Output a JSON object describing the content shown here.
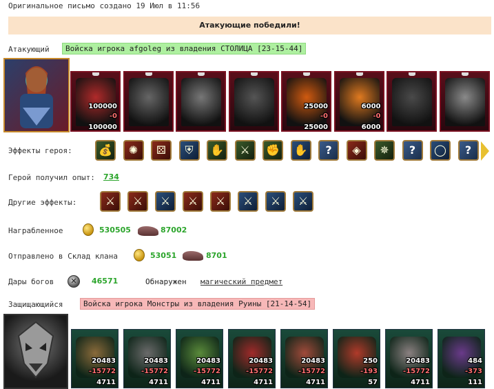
{
  "header": {
    "date_text": "Оригинальное письмо создано 19 Июл в 11:56"
  },
  "banner": {
    "text": "Атакующие победили!"
  },
  "attacker": {
    "label": "Атакующий",
    "tag": "Войска игрока afgoleg из владения СТОЛИЦА [23-15-44]",
    "portrait_icon": "hero-portrait",
    "units": [
      {
        "icon": "red-dragon-unit",
        "top": "100000",
        "delta": "-0",
        "bottom": "100000",
        "color": "#b02a2a"
      },
      {
        "icon": "skeleton-lord-unit",
        "top": "",
        "delta": "",
        "bottom": "",
        "color": "#666666"
      },
      {
        "icon": "ghoul-unit",
        "top": "",
        "delta": "",
        "bottom": "",
        "color": "#777777"
      },
      {
        "icon": "gargoyle-unit",
        "top": "",
        "delta": "",
        "bottom": "",
        "color": "#555555"
      },
      {
        "icon": "fire-elemental-unit",
        "top": "25000",
        "delta": "-0",
        "bottom": "25000",
        "color": "#d05a10"
      },
      {
        "icon": "flame-warrior-unit",
        "top": "6000",
        "delta": "-0",
        "bottom": "6000",
        "color": "#e07a20"
      },
      {
        "icon": "demon-lord-unit",
        "top": "",
        "delta": "",
        "bottom": "",
        "color": "#4a4a4a"
      },
      {
        "icon": "wraith-unit",
        "top": "",
        "delta": "",
        "bottom": "",
        "color": "#8a8a8a"
      }
    ]
  },
  "hero_effects": {
    "label": "Эффекты героя:",
    "items": [
      {
        "icon": "gold-bag-icon",
        "glyph": "💰",
        "style": ""
      },
      {
        "icon": "crab-icon",
        "glyph": "✺",
        "style": "red"
      },
      {
        "icon": "dice-icon",
        "glyph": "⚄",
        "style": "red"
      },
      {
        "icon": "shield-icon",
        "glyph": "⛨",
        "style": "blue"
      },
      {
        "icon": "shield-hand-icon",
        "glyph": "✋",
        "style": ""
      },
      {
        "icon": "green-sword-icon",
        "glyph": "⚔",
        "style": ""
      },
      {
        "icon": "handshake-icon",
        "glyph": "✊",
        "style": ""
      },
      {
        "icon": "blue-hand-icon",
        "glyph": "✋",
        "style": "blue"
      },
      {
        "icon": "question-icon",
        "glyph": "?",
        "style": "q"
      },
      {
        "icon": "red-amulet-icon",
        "glyph": "◈",
        "style": "red"
      },
      {
        "icon": "star-gear-icon",
        "glyph": "✵",
        "style": ""
      },
      {
        "icon": "question-icon",
        "glyph": "?",
        "style": "q"
      },
      {
        "icon": "ring-icon",
        "glyph": "◯",
        "style": "blue"
      },
      {
        "icon": "question-icon",
        "glyph": "?",
        "style": "q"
      }
    ]
  },
  "experience": {
    "label": "Герой получил опыт:",
    "value": "734"
  },
  "other_effects": {
    "label": "Другие эффекты:",
    "items": [
      {
        "icon": "fist-sword-icon",
        "glyph": "⚔",
        "style": "red"
      },
      {
        "icon": "fist-sword-icon",
        "glyph": "⚔",
        "style": "red"
      },
      {
        "icon": "blue-sword-icon",
        "glyph": "⚔",
        "style": "blue"
      },
      {
        "icon": "fist-sword-icon",
        "glyph": "⚔",
        "style": "red"
      },
      {
        "icon": "fist-sword-icon",
        "glyph": "⚔",
        "style": "red"
      },
      {
        "icon": "blue-sword-icon",
        "glyph": "⚔",
        "style": "blue"
      },
      {
        "icon": "blue-sword-icon",
        "glyph": "⚔",
        "style": "blue"
      },
      {
        "icon": "blue-sword-icon",
        "glyph": "⚔",
        "style": "blue"
      }
    ]
  },
  "loot": {
    "label": "Награбленное",
    "gold": "530505",
    "ore": "87002"
  },
  "clan": {
    "label": "Отправлено в Склад клана",
    "gold": "53051",
    "ore": "8701"
  },
  "gifts": {
    "label": "Дары богов",
    "value": "46571",
    "found_label": "Обнаружен",
    "found_link": "магический предмет"
  },
  "defender": {
    "label": "Защищающийся",
    "tag": "Войска игрока Монстры из владения Руины [21-14-54]",
    "portrait_icon": "monster-skull-portrait",
    "units": [
      {
        "icon": "basilisk-unit",
        "top": "20483",
        "delta": "-15772",
        "bottom": "4711",
        "color": "#8a6a3a"
      },
      {
        "icon": "golem-unit",
        "top": "20483",
        "delta": "-15772",
        "bottom": "4711",
        "color": "#6a6a6a"
      },
      {
        "icon": "orc-warrior-unit",
        "top": "20483",
        "delta": "-15772",
        "bottom": "4711",
        "color": "#5a8a3a"
      },
      {
        "icon": "red-demon-unit",
        "top": "20483",
        "delta": "-15772",
        "bottom": "4711",
        "color": "#a02a2a"
      },
      {
        "icon": "spider-unit",
        "top": "20483",
        "delta": "-15772",
        "bottom": "4711",
        "color": "#a04a3a"
      },
      {
        "icon": "imp-unit",
        "top": "250",
        "delta": "-193",
        "bottom": "57",
        "color": "#b03a2a"
      },
      {
        "icon": "stone-knight-unit",
        "top": "20483",
        "delta": "-15772",
        "bottom": "4711",
        "color": "#8a8080"
      },
      {
        "icon": "serpent-mage-unit",
        "top": "484",
        "delta": "-373",
        "bottom": "111",
        "color": "#6a3a8a"
      }
    ]
  }
}
